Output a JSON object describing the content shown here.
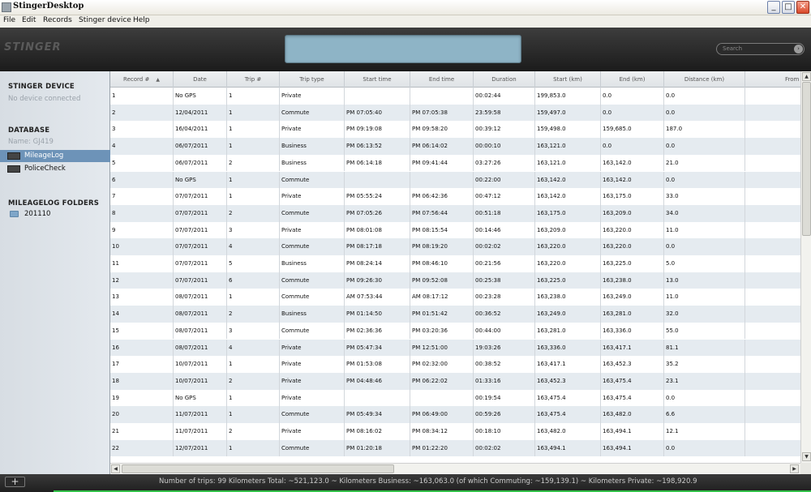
{
  "window": {
    "title": "StingerDesktop",
    "min": "_",
    "max": "□",
    "close": "✕"
  },
  "menu": [
    "File",
    "Edit",
    "Records",
    "Stinger device",
    "Help"
  ],
  "header": {
    "logo": "STINGER",
    "search_placeholder": "Search",
    "search_go": "›"
  },
  "sidebar": {
    "device_heading": "STINGER DEVICE",
    "device_status": "No device connected",
    "database_heading": "DATABASE",
    "database_name": "Name: GJ419",
    "items": [
      {
        "label": "MileageLog",
        "icon": "mileage-log-icon",
        "selected": true
      },
      {
        "label": "PoliceCheck",
        "icon": "police-check-icon",
        "selected": false
      }
    ],
    "folders_heading": "MILEAGELOG FOLDERS",
    "folders": [
      {
        "label": "201110",
        "icon": "folder-icon"
      }
    ]
  },
  "table": {
    "sort_indicator": "▲",
    "columns": [
      "Record #",
      "Date",
      "Trip #",
      "Trip type",
      "Start time",
      "End time",
      "Duration",
      "Start (km)",
      "End (km)",
      "Distance (km)",
      "From postal"
    ],
    "rows": [
      [
        "1",
        "No GPS",
        "1",
        "Private",
        "",
        "",
        "00:02:44",
        "199,853.0",
        "0.0",
        "0.0",
        ""
      ],
      [
        "2",
        "12/04/2011",
        "1",
        "Commute",
        "PM 07:05:40",
        "PM 07:05:38",
        "23:59:58",
        "159,497.0",
        "0.0",
        "0.0",
        ""
      ],
      [
        "3",
        "16/04/2011",
        "1",
        "Private",
        "PM 09:19:08",
        "PM 09:58:20",
        "00:39:12",
        "159,498.0",
        "159,685.0",
        "187.0",
        ""
      ],
      [
        "4",
        "06/07/2011",
        "1",
        "Business",
        "PM 06:13:52",
        "PM 06:14:02",
        "00:00:10",
        "163,121.0",
        "0.0",
        "0.0",
        ""
      ],
      [
        "5",
        "06/07/2011",
        "2",
        "Business",
        "PM 06:14:18",
        "PM 09:41:44",
        "03:27:26",
        "163,121.0",
        "163,142.0",
        "21.0",
        ""
      ],
      [
        "6",
        "No GPS",
        "1",
        "Commute",
        "",
        "",
        "00:22:00",
        "163,142.0",
        "163,142.0",
        "0.0",
        ""
      ],
      [
        "7",
        "07/07/2011",
        "1",
        "Private",
        "PM 05:55:24",
        "PM 06:42:36",
        "00:47:12",
        "163,142.0",
        "163,175.0",
        "33.0",
        ""
      ],
      [
        "8",
        "07/07/2011",
        "2",
        "Commute",
        "PM 07:05:26",
        "PM 07:56:44",
        "00:51:18",
        "163,175.0",
        "163,209.0",
        "34.0",
        ""
      ],
      [
        "9",
        "07/07/2011",
        "3",
        "Private",
        "PM 08:01:08",
        "PM 08:15:54",
        "00:14:46",
        "163,209.0",
        "163,220.0",
        "11.0",
        ""
      ],
      [
        "10",
        "07/07/2011",
        "4",
        "Commute",
        "PM 08:17:18",
        "PM 08:19:20",
        "00:02:02",
        "163,220.0",
        "163,220.0",
        "0.0",
        ""
      ],
      [
        "11",
        "07/07/2011",
        "5",
        "Business",
        "PM 08:24:14",
        "PM 08:46:10",
        "00:21:56",
        "163,220.0",
        "163,225.0",
        "5.0",
        ""
      ],
      [
        "12",
        "07/07/2011",
        "6",
        "Commute",
        "PM 09:26:30",
        "PM 09:52:08",
        "00:25:38",
        "163,225.0",
        "163,238.0",
        "13.0",
        ""
      ],
      [
        "13",
        "08/07/2011",
        "1",
        "Commute",
        "AM 07:53:44",
        "AM 08:17:12",
        "00:23:28",
        "163,238.0",
        "163,249.0",
        "11.0",
        ""
      ],
      [
        "14",
        "08/07/2011",
        "2",
        "Business",
        "PM 01:14:50",
        "PM 01:51:42",
        "00:36:52",
        "163,249.0",
        "163,281.0",
        "32.0",
        ""
      ],
      [
        "15",
        "08/07/2011",
        "3",
        "Commute",
        "PM 02:36:36",
        "PM 03:20:36",
        "00:44:00",
        "163,281.0",
        "163,336.0",
        "55.0",
        ""
      ],
      [
        "16",
        "08/07/2011",
        "4",
        "Private",
        "PM 05:47:34",
        "PM 12:51:00",
        "19:03:26",
        "163,336.0",
        "163,417.1",
        "81.1",
        ""
      ],
      [
        "17",
        "10/07/2011",
        "1",
        "Private",
        "PM 01:53:08",
        "PM 02:32:00",
        "00:38:52",
        "163,417.1",
        "163,452.3",
        "35.2",
        ""
      ],
      [
        "18",
        "10/07/2011",
        "2",
        "Private",
        "PM 04:48:46",
        "PM 06:22:02",
        "01:33:16",
        "163,452.3",
        "163,475.4",
        "23.1",
        ""
      ],
      [
        "19",
        "No GPS",
        "1",
        "Private",
        "",
        "",
        "00:19:54",
        "163,475.4",
        "163,475.4",
        "0.0",
        ""
      ],
      [
        "20",
        "11/07/2011",
        "1",
        "Commute",
        "PM 05:49:34",
        "PM 06:49:00",
        "00:59:26",
        "163,475.4",
        "163,482.0",
        "6.6",
        ""
      ],
      [
        "21",
        "11/07/2011",
        "2",
        "Private",
        "PM 08:16:02",
        "PM 08:34:12",
        "00:18:10",
        "163,482.0",
        "163,494.1",
        "12.1",
        ""
      ],
      [
        "22",
        "12/07/2011",
        "1",
        "Commute",
        "PM 01:20:18",
        "PM 01:22:20",
        "00:02:02",
        "163,494.1",
        "163,494.1",
        "0.0",
        ""
      ]
    ]
  },
  "scroll": {
    "up": "▲",
    "down": "▼",
    "left": "◀",
    "right": "▶"
  },
  "statusbar": {
    "add_label": "+",
    "text": "Number of trips: 99   Kilometers Total: ~521,123.0 ~ Kilometers Business: ~163,063.0 (of which Commuting: ~159,139.1) ~ Kilometers Private: ~198,920.9"
  },
  "colors": {
    "header_bg": "#2b2b2b",
    "lcd": "#8eb4c6",
    "sidebar_selected": "#6d93b8",
    "row_alt": "#e5ebf0",
    "accent_green": "#33c24a"
  }
}
